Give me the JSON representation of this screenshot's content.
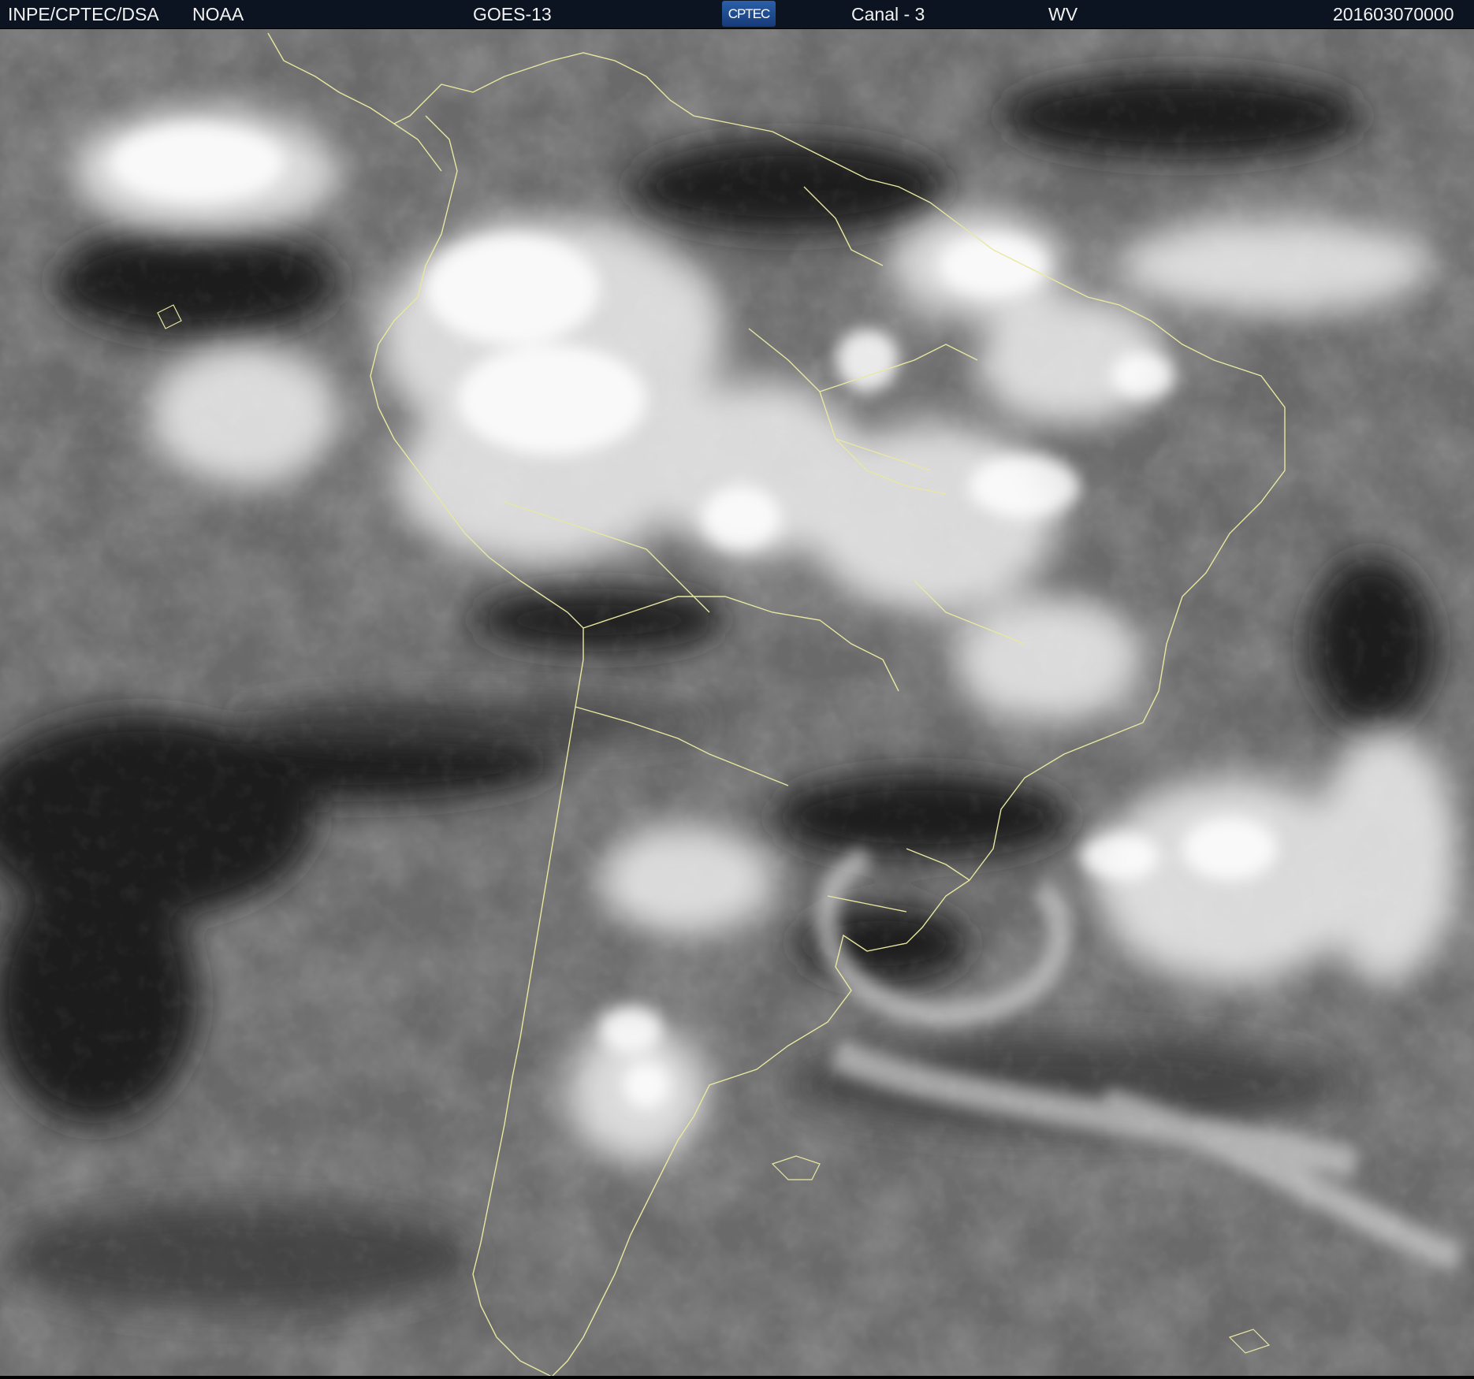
{
  "header": {
    "source": "INPE/CPTEC/DSA",
    "agency": "NOAA",
    "satellite": "GOES-13",
    "logo_text": "CPTEC",
    "channel": "Canal - 3",
    "band": "WV",
    "timestamp": "201603070000",
    "background_color": "#0b1420",
    "text_color": "#f2f2f2"
  },
  "image": {
    "description_colors": {
      "coastline": "#e8e8a0",
      "cloud_bright": "#f2f2f2",
      "dry_air_dark": "#1a1a1a"
    }
  }
}
